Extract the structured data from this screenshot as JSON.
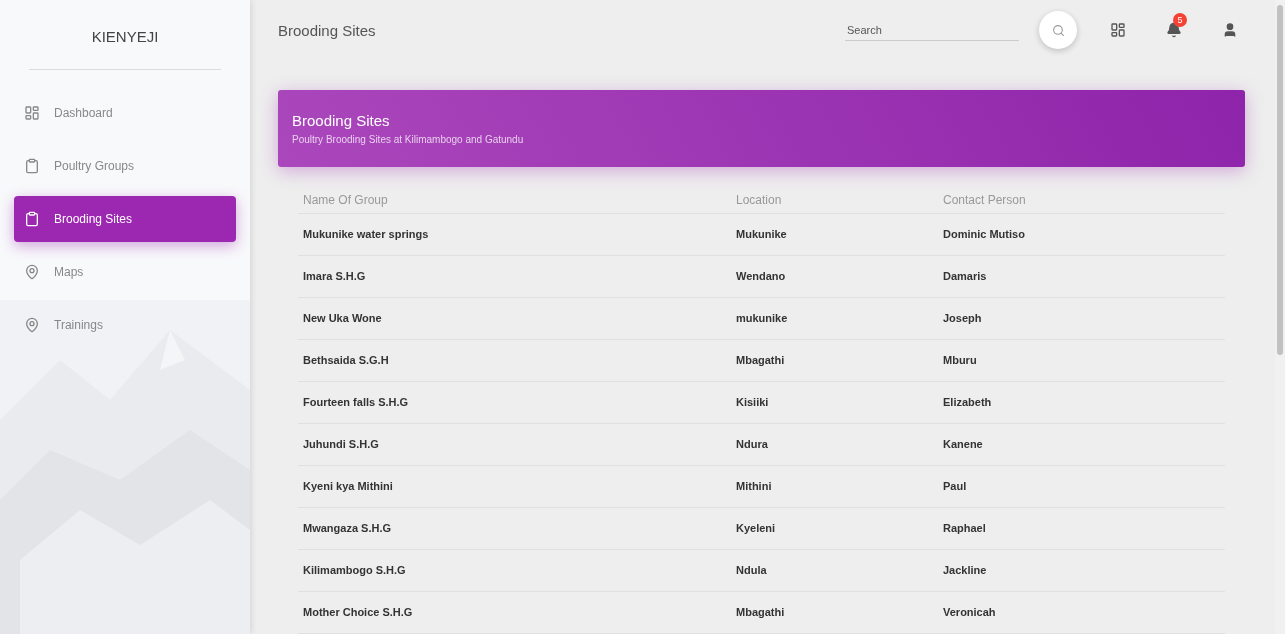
{
  "sidebar": {
    "logo": "KIENYEJI",
    "items": [
      {
        "label": "Dashboard",
        "kind": "grid",
        "selected": false
      },
      {
        "label": "Poultry Groups",
        "kind": "clipboard",
        "selected": false
      },
      {
        "label": "Brooding Sites",
        "kind": "clipboard",
        "selected": true
      },
      {
        "label": "Maps",
        "kind": "pin",
        "selected": false
      },
      {
        "label": "Trainings",
        "kind": "pin",
        "selected": false
      }
    ]
  },
  "header": {
    "title": "Brooding Sites",
    "search": {
      "placeholder": "Search"
    },
    "notifications": {
      "badge": "5"
    }
  },
  "card": {
    "title": "Brooding Sites",
    "subtitle": "Poultry Brooding Sites at Kilimambogo and Gatundu"
  },
  "table": {
    "columns": [
      "Name Of Group",
      "Location",
      "Contact Person"
    ],
    "rows": [
      [
        "Mukunike water springs",
        "Mukunike",
        "Dominic Mutiso"
      ],
      [
        "Imara S.H.G",
        "Wendano",
        "Damaris"
      ],
      [
        "New Uka Wone",
        "mukunike",
        "Joseph"
      ],
      [
        "Bethsaida S.G.H",
        "Mbagathi",
        "Mburu"
      ],
      [
        "Fourteen falls S.H.G",
        "Kisiiki",
        "Elizabeth"
      ],
      [
        "Juhundi S.H.G",
        "Ndura",
        "Kanene"
      ],
      [
        "Kyeni kya Mithini",
        "Mithini",
        "Paul"
      ],
      [
        "Mwangaza S.H.G",
        "Kyeleni",
        "Raphael"
      ],
      [
        "Kilimambogo S.H.G",
        "Ndula",
        "Jackline"
      ],
      [
        "Mother Choice S.H.G",
        "Mbagathi",
        "Veronicah"
      ]
    ]
  }
}
